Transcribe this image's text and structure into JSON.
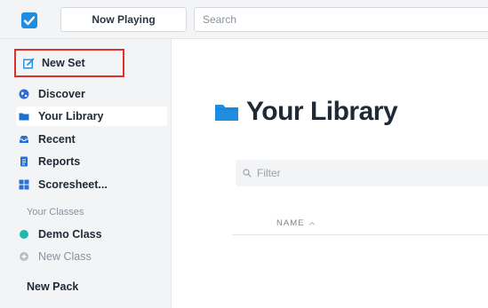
{
  "topbar": {
    "now_playing_label": "Now Playing",
    "search_placeholder": "Search"
  },
  "sidebar": {
    "new_set_label": "New Set",
    "items": [
      {
        "label": "Discover",
        "icon": "globe-icon"
      },
      {
        "label": "Your Library",
        "icon": "folder-icon",
        "active": true
      },
      {
        "label": "Recent",
        "icon": "inbox-icon"
      },
      {
        "label": "Reports",
        "icon": "report-icon"
      },
      {
        "label": "Scoresheet...",
        "icon": "grid-icon"
      }
    ],
    "classes_heading": "Your Classes",
    "classes": [
      {
        "label": "Demo Class",
        "icon": "teal-dot-icon"
      },
      {
        "label": "New Class",
        "icon": "plus-circle-icon"
      }
    ],
    "new_pack_label": "New Pack"
  },
  "main": {
    "title": "Your Library",
    "filter_placeholder": "Filter",
    "column_name": "NAME"
  },
  "colors": {
    "accent": "#1f8ee0",
    "highlight_border": "#e0302b",
    "teal": "#22b8b0",
    "sidebar_bg": "#f3f4f6"
  }
}
